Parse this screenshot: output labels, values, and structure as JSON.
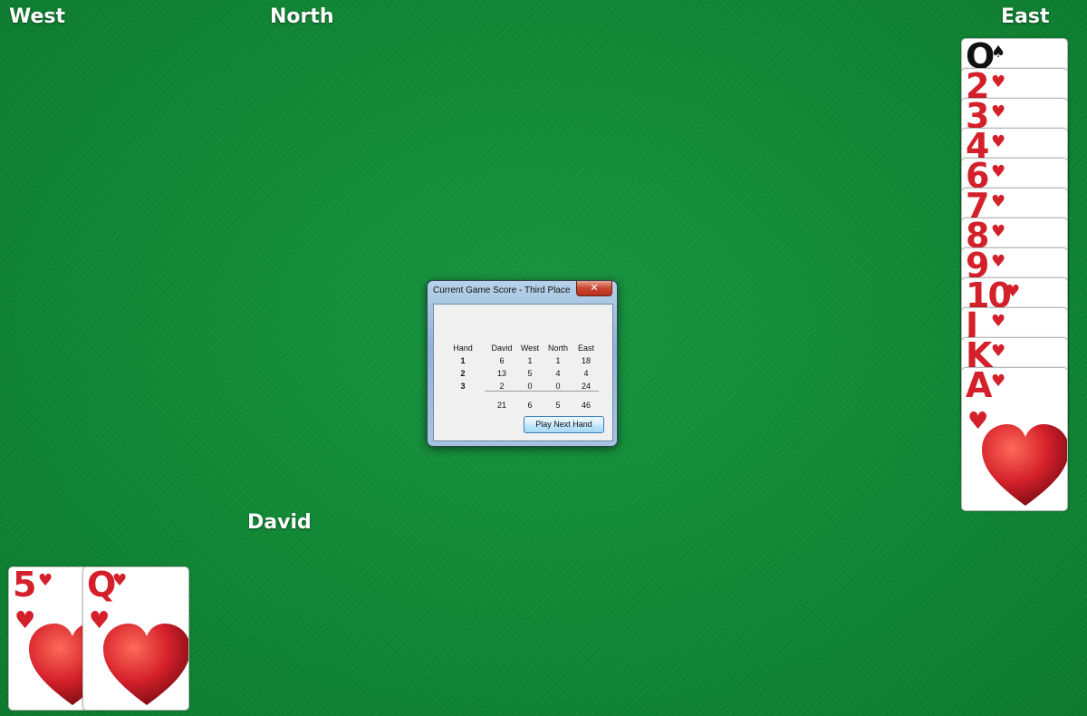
{
  "players": {
    "west": "West",
    "north": "North",
    "east": "East",
    "south": "David"
  },
  "east_hand": [
    {
      "rank": "Q",
      "suit": "♠",
      "color": "#111111"
    },
    {
      "rank": "2",
      "suit": "♥",
      "color": "#d4202a"
    },
    {
      "rank": "3",
      "suit": "♥",
      "color": "#d4202a"
    },
    {
      "rank": "4",
      "suit": "♥",
      "color": "#d4202a"
    },
    {
      "rank": "6",
      "suit": "♥",
      "color": "#d4202a"
    },
    {
      "rank": "7",
      "suit": "♥",
      "color": "#d4202a"
    },
    {
      "rank": "8",
      "suit": "♥",
      "color": "#d4202a"
    },
    {
      "rank": "9",
      "suit": "♥",
      "color": "#d4202a"
    },
    {
      "rank": "10",
      "suit": "♥",
      "color": "#d4202a"
    },
    {
      "rank": "J",
      "suit": "♥",
      "color": "#d4202a"
    },
    {
      "rank": "K",
      "suit": "♥",
      "color": "#d4202a"
    },
    {
      "rank": "A",
      "suit": "♥",
      "color": "#d4202a"
    }
  ],
  "south_hand": [
    {
      "rank": "5",
      "suit": "♥",
      "color": "#d4202a"
    },
    {
      "rank": "Q",
      "suit": "♥",
      "color": "#d4202a"
    }
  ],
  "dialog": {
    "title": "Current Game Score - Third Place",
    "close_glyph": "✕",
    "headers": {
      "hand": "Hand",
      "david": "David",
      "west": "West",
      "north": "North",
      "east": "East"
    },
    "rows": [
      {
        "hand": "1",
        "david": "6",
        "west": "1",
        "north": "1",
        "east": "18"
      },
      {
        "hand": "2",
        "david": "13",
        "west": "5",
        "north": "4",
        "east": "4"
      },
      {
        "hand": "3",
        "david": "2",
        "west": "0",
        "north": "0",
        "east": "24"
      }
    ],
    "totals": {
      "david": "21",
      "west": "6",
      "north": "5",
      "east": "46"
    },
    "button": "Play Next Hand"
  },
  "colors": {
    "felt": "#108a36",
    "heart_red": "#d4202a",
    "spade_black": "#111111"
  }
}
